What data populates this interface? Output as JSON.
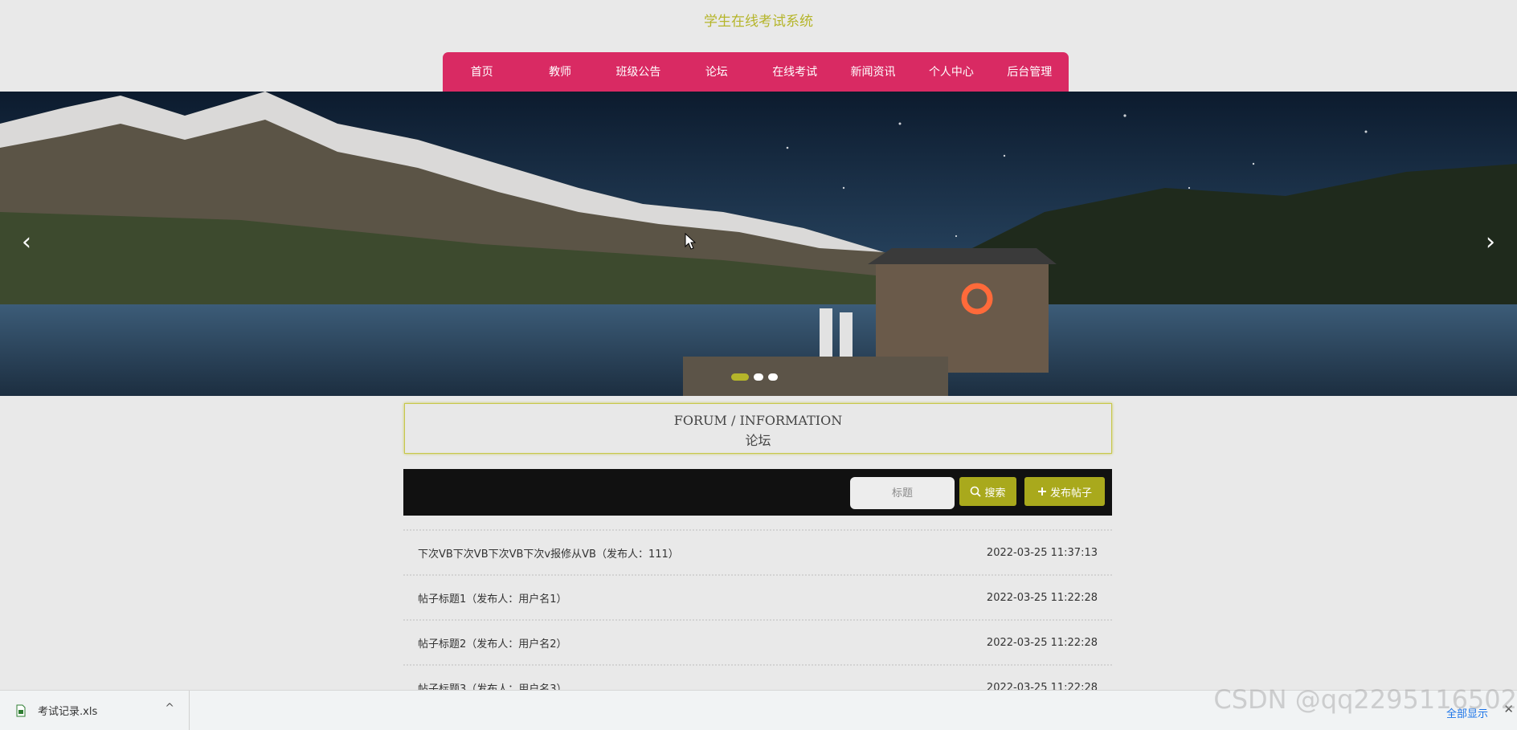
{
  "header": {
    "title": "学生在线考试系统"
  },
  "nav": {
    "items": [
      {
        "label": "首页"
      },
      {
        "label": "教师"
      },
      {
        "label": "班级公告"
      },
      {
        "label": "论坛"
      },
      {
        "label": "在线考试"
      },
      {
        "label": "新闻资讯"
      },
      {
        "label": "个人中心"
      },
      {
        "label": "后台管理"
      }
    ]
  },
  "banner": {
    "prev_icon": "‹",
    "next_icon": "›",
    "dots": 3,
    "active_dot": 0
  },
  "section": {
    "title_en": "FORUM / INFORMATION",
    "title_cn": "论坛"
  },
  "search": {
    "placeholder": "标题",
    "search_label": "搜索",
    "post_label": "发布帖子"
  },
  "posts": [
    {
      "title": "下次VB下次VB下次VB下次v报修从VB（发布人：111）",
      "time": "2022-03-25 11:37:13"
    },
    {
      "title": "帖子标题1（发布人：用户名1）",
      "time": "2022-03-25 11:22:28"
    },
    {
      "title": "帖子标题2（发布人：用户名2）",
      "time": "2022-03-25 11:22:28"
    },
    {
      "title": "帖子标题3（发布人：用户名3）",
      "time": "2022-03-25 11:22:28"
    }
  ],
  "downloads": {
    "file_name": "考试记录.xls",
    "chevron": "^",
    "show_all": "全部显示",
    "close": "✕"
  },
  "watermark": "CSDN @qq2295116502",
  "colors": {
    "accent": "#b5b52a",
    "nav_bg": "#d92a63",
    "toolbar_bg": "#111111",
    "button_bg": "#a9a91c"
  }
}
